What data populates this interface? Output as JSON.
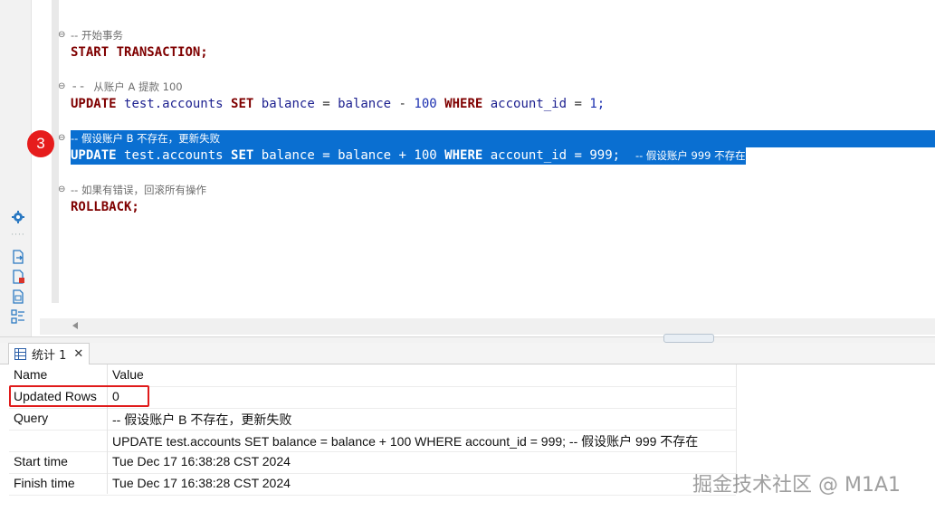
{
  "editor": {
    "lines": [
      {
        "comment": "-- 开始事务"
      },
      {
        "tokens": [
          "START",
          "TRANSACTION;"
        ]
      },
      {
        "comment_prefix": "-- ",
        "comment_text": "从账户 A 提款 100"
      },
      {
        "update_a": {
          "kw1": "UPDATE",
          "table": "test.accounts",
          "kw2": "SET",
          "col": "balance",
          "eq": "=",
          "col2": "balance",
          "op": "-",
          "num": "100",
          "kw3": "WHERE",
          "col3": "account_id",
          "eq2": "=",
          "val": "1;"
        }
      },
      {
        "comment": "-- 假设账户 B 不存在，更新失败"
      },
      {
        "update_b": {
          "kw1": "UPDATE",
          "table": "test.accounts",
          "kw2": "SET",
          "col": "balance",
          "eq": "=",
          "col2": "balance",
          "op": "+",
          "num": "100",
          "kw3": "WHERE",
          "col3": "account_id",
          "eq2": "=",
          "val": "999;",
          "trail": "-- 假设账户 999 不存在"
        }
      },
      {
        "comment": "-- 如果有错误，回滚所有操作"
      },
      {
        "tokens": [
          "ROLLBACK;"
        ]
      }
    ],
    "step_badge": "3"
  },
  "results": {
    "tab_label": "统计 1",
    "tab_close": "✕",
    "columns": [
      "Name",
      "Value"
    ],
    "rows": [
      {
        "name": "Updated Rows",
        "value": "0"
      },
      {
        "name": "Query",
        "value": "-- 假设账户 B 不存在，更新失败"
      },
      {
        "name": "",
        "value": "UPDATE test.accounts SET balance = balance + 100 WHERE account_id = 999; -- 假设账户 999 不存在"
      },
      {
        "name": "Start time",
        "value": "Tue Dec 17 16:38:28 CST 2024"
      },
      {
        "name": "Finish time",
        "value": "Tue Dec 17 16:38:28 CST 2024"
      }
    ]
  },
  "watermark": "掘金技术社区 @ M1A1",
  "icons": [
    "gear-icon",
    "export-icon",
    "file-error-icon",
    "sql-file-icon",
    "structure-icon",
    "grid-icon"
  ],
  "colors": {
    "selection": "#0a6fd1",
    "keyword": "#7f0000",
    "badge": "#e61c1c",
    "highlight": "#e01b1b"
  }
}
